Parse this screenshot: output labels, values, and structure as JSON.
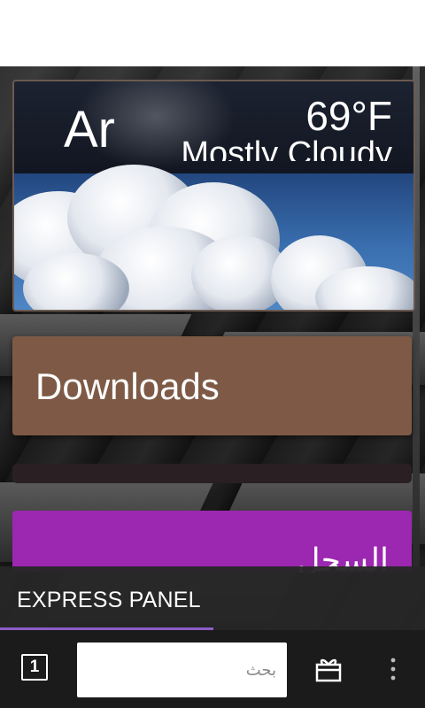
{
  "weather": {
    "city": "Ar",
    "temperature": "69°F",
    "condition": "Mostly Cloudy"
  },
  "tiles": {
    "downloads_label": "Downloads",
    "history_label": "السجل"
  },
  "express_panel": {
    "label": "EXPRESS PANEL"
  },
  "toolbar": {
    "tab_count": "1",
    "search_placeholder": "بحث",
    "icons": {
      "tabs": "tabs-counter-icon",
      "offers": "gift-icon",
      "menu": "overflow-menu-icon"
    }
  },
  "colors": {
    "downloads_tile": "#7e5a46",
    "history_tile": "#9c27b0",
    "express_indicator": "#8e5cc8"
  }
}
